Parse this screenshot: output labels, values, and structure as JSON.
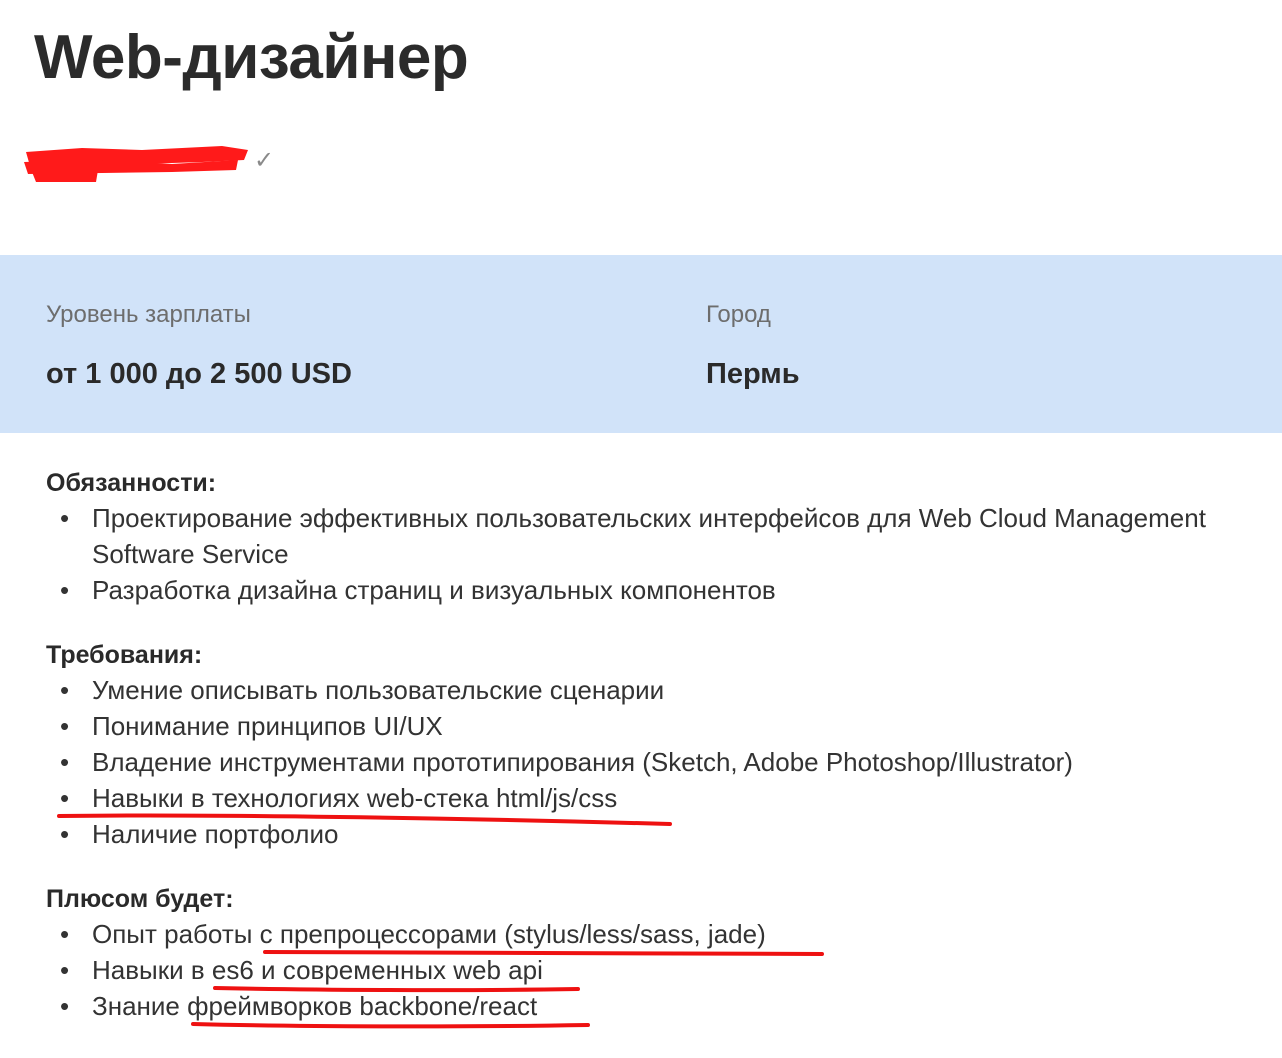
{
  "page": {
    "title": "Web-дизайнер"
  },
  "employer": {
    "verified_icon": "check-icon",
    "redaction_color": "#ff1a1a"
  },
  "info": {
    "salary_label": "Уровень зарплаты",
    "salary_value": "от 1 000 до 2 500 USD",
    "city_label": "Город",
    "city_value": "Пермь",
    "band_color": "#d1e3f9"
  },
  "sections": {
    "duties": {
      "title": "Обязанности:",
      "items": [
        "Проектирование эффективных пользовательских интерфейсов для Web Cloud Management Software Service",
        "Разработка дизайна страниц и визуальных компонентов"
      ]
    },
    "requirements": {
      "title": "Требования:",
      "items": [
        "Умение описывать пользовательские сценарии",
        "Понимание принципов UI/UX",
        "Владение инструментами прототипирования (Sketch, Adobe Photoshop/Illustrator)",
        "Навыки в технологиях web-стека html/js/css",
        "Наличие портфолио"
      ]
    },
    "plus": {
      "title": "Плюсом будет:",
      "items": [
        "Опыт работы с препроцессорами (stylus/less/sass, jade)",
        "Навыки в es6 и современных web api",
        "Знание фреймворков backbone/react"
      ]
    }
  },
  "annotation_color": "#ee1111"
}
